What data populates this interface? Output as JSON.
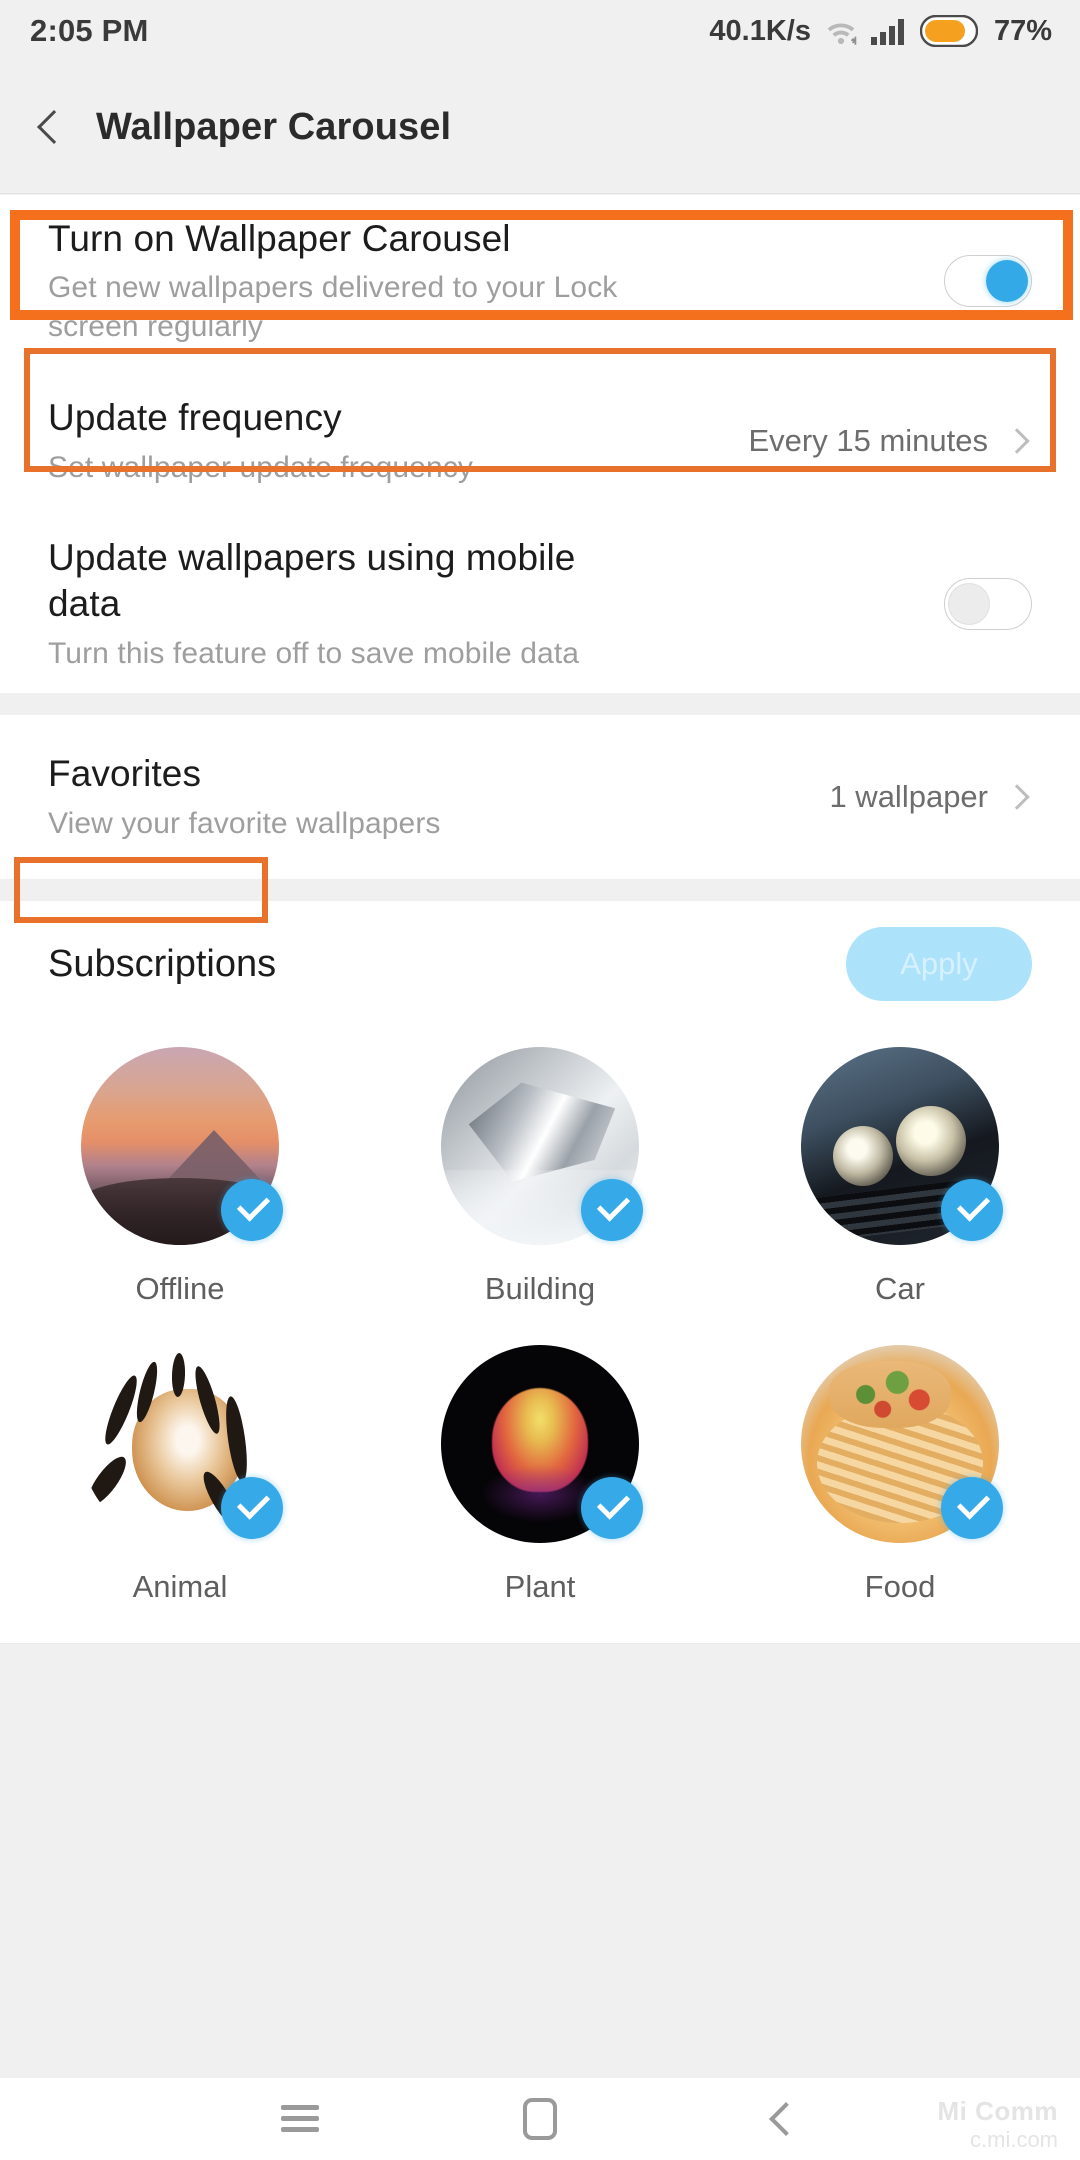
{
  "status_bar": {
    "time": "2:05 PM",
    "network_speed": "40.1K/s",
    "battery_percent": "77%",
    "wifi_icon": "wifi-icon",
    "signal_icon": "signal-bars-icon",
    "battery_icon": "battery-icon"
  },
  "app_bar": {
    "back_icon": "back-chevron-icon",
    "title": "Wallpaper Carousel"
  },
  "settings": {
    "carousel_toggle": {
      "title": "Turn on Wallpaper Carousel",
      "subtitle": "Get new wallpapers delivered to your Lock screen regularly",
      "state": "on"
    },
    "update_frequency": {
      "title": "Update frequency",
      "subtitle": "Set wallpaper update frequency",
      "value": "Every 15 minutes",
      "chevron_icon": "chevron-right-icon"
    },
    "mobile_data": {
      "title": "Update wallpapers using mobile data",
      "subtitle": "Turn this feature off to save mobile data",
      "state": "off"
    },
    "favorites": {
      "title": "Favorites",
      "subtitle": "View your favorite wallpapers",
      "value": "1 wallpaper",
      "chevron_icon": "chevron-right-icon"
    }
  },
  "subscriptions": {
    "title": "Subscriptions",
    "apply_label": "Apply",
    "apply_enabled": false,
    "items": [
      {
        "label": "Offline",
        "selected": true,
        "art": "offline"
      },
      {
        "label": "Building",
        "selected": true,
        "art": "building"
      },
      {
        "label": "Car",
        "selected": true,
        "art": "car"
      },
      {
        "label": "Animal",
        "selected": true,
        "art": "animal"
      },
      {
        "label": "Plant",
        "selected": true,
        "art": "plant"
      },
      {
        "label": "Food",
        "selected": true,
        "art": "food"
      }
    ],
    "check_icon": "checkmark-icon"
  },
  "nav_bar": {
    "menu_icon": "menu-icon",
    "home_icon": "home-icon",
    "back_icon": "back-icon"
  },
  "watermark": {
    "line1": "Mi Comm",
    "line2": "c.mi.com"
  },
  "colors": {
    "highlight": "#f4701d",
    "toggle_on": "#34a9e8",
    "check": "#36a9e8",
    "apply_bg": "#ade2fb",
    "battery": "#f5a01e"
  }
}
